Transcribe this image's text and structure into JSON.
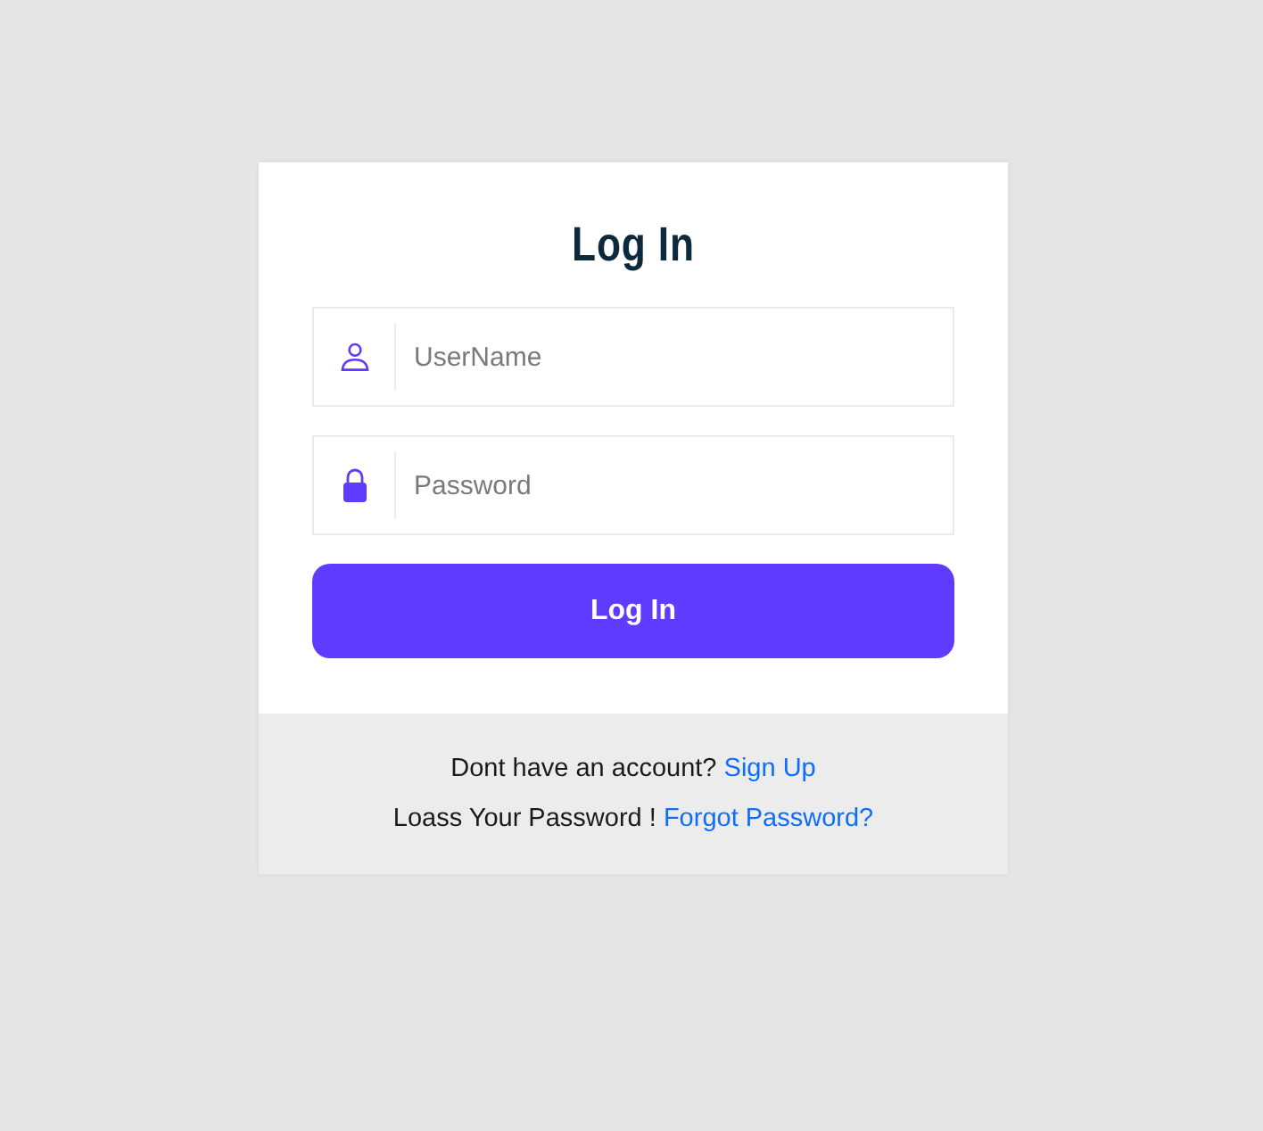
{
  "title": "Log In",
  "fields": [
    {
      "kind": "user",
      "placeholder": "UserName"
    },
    {
      "kind": "password",
      "placeholder": "Password"
    }
  ],
  "submit": "Log In",
  "footer": [
    {
      "text": "Dont have an account?",
      "link": "Sign Up"
    },
    {
      "text": "Loass Your Password !",
      "link": "Forgot Password?"
    }
  ]
}
